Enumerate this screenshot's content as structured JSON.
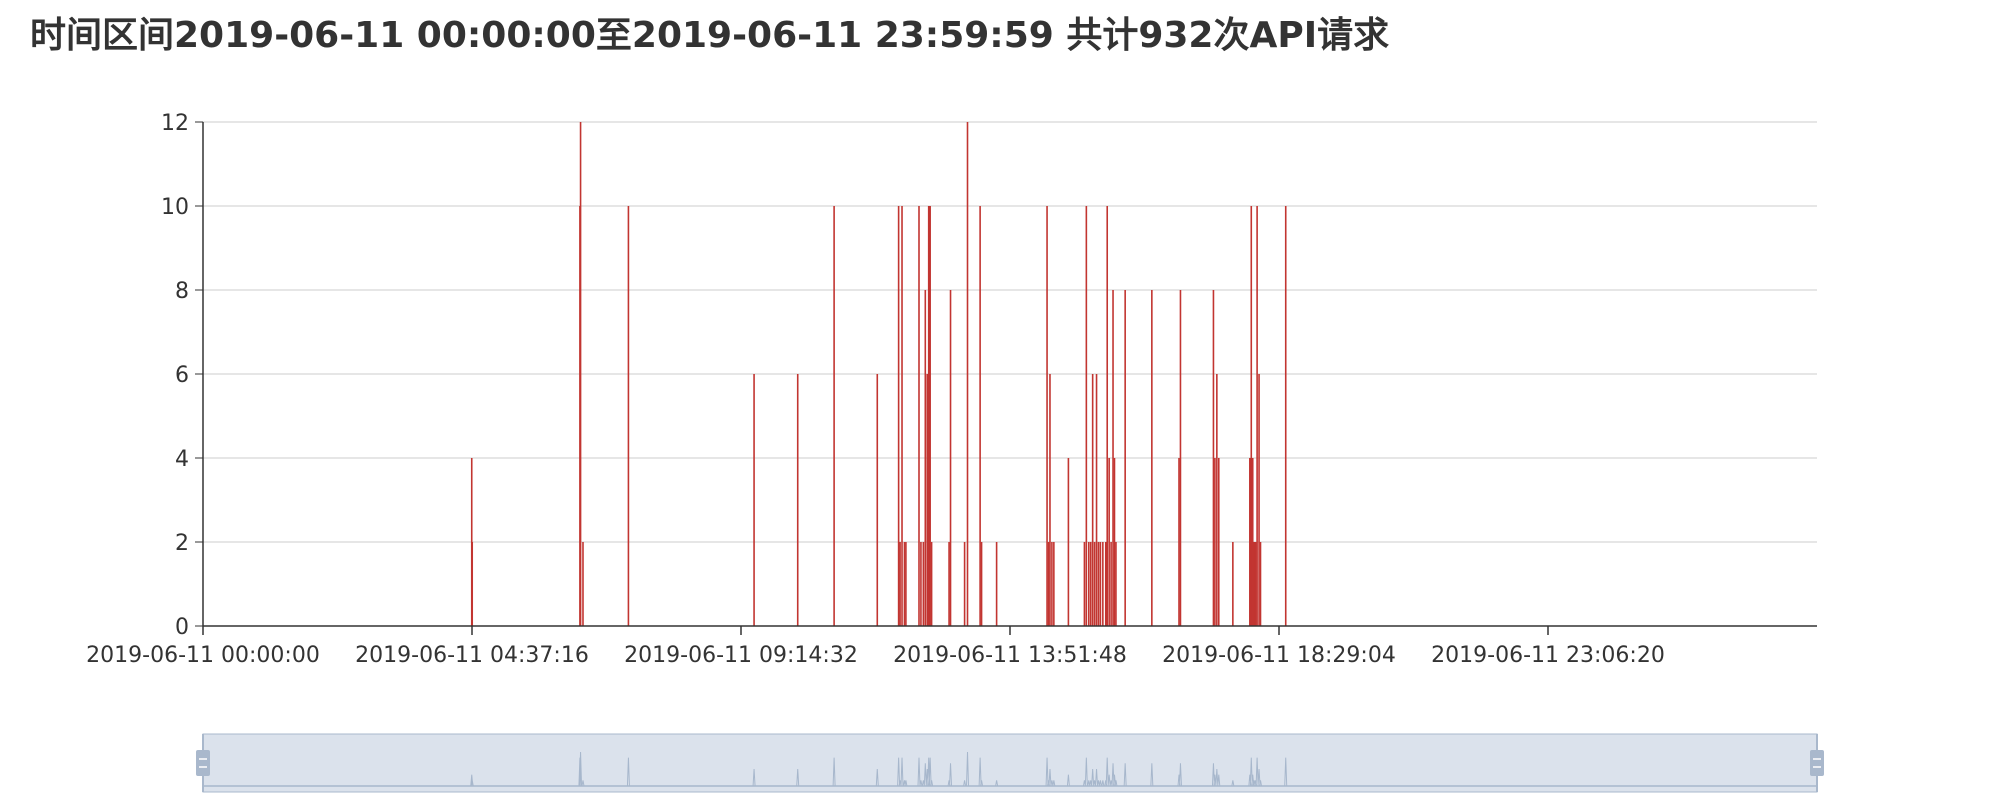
{
  "title": "时间区间2019-06-11 00:00:00至2019-06-11 23:59:59 共计932次API请求",
  "colors": {
    "series": "#c23531",
    "grid": "#cccccc",
    "axis": "#333333",
    "zoom_fill": "#dbe2ec",
    "zoom_border": "#a9b8cc",
    "zoom_shadow": "#a7b7cc"
  },
  "chart_data": {
    "type": "bar",
    "title": "时间区间2019-06-11 00:00:00至2019-06-11 23:59:59 共计932次API请求",
    "xlabel": "",
    "ylabel": "",
    "ylim": [
      0,
      12
    ],
    "y_ticks": [
      "0",
      "2",
      "4",
      "6",
      "8",
      "10",
      "12"
    ],
    "x_ticks": [
      "2019-06-11 00:00:00",
      "2019-06-11 04:37:16",
      "2019-06-11 09:14:32",
      "2019-06-11 13:51:48",
      "2019-06-11 18:29:04",
      "2019-06-11 23:06:20"
    ],
    "grid": true,
    "data_zoom": {
      "start_percent": 0,
      "end_percent": 100
    },
    "series": [
      {
        "values": [
          [
            "2019-06-11 04:37:00",
            4
          ],
          [
            "2019-06-11 04:37:30",
            2
          ],
          [
            "2019-06-11 06:28:30",
            10
          ],
          [
            "2019-06-11 06:29:10",
            12
          ],
          [
            "2019-06-11 06:31:40",
            2
          ],
          [
            "2019-06-11 07:18:30",
            10
          ],
          [
            "2019-06-11 09:28:00",
            6
          ],
          [
            "2019-06-11 10:13:00",
            6
          ],
          [
            "2019-06-11 10:50:30",
            10
          ],
          [
            "2019-06-11 11:35:00",
            6
          ],
          [
            "2019-06-11 11:57:00",
            10
          ],
          [
            "2019-06-11 11:58:30",
            2
          ],
          [
            "2019-06-11 12:00:30",
            10
          ],
          [
            "2019-06-11 12:03:00",
            2
          ],
          [
            "2019-06-11 12:04:30",
            2
          ],
          [
            "2019-06-11 12:18:00",
            10
          ],
          [
            "2019-06-11 12:20:00",
            2
          ],
          [
            "2019-06-11 12:22:30",
            2
          ],
          [
            "2019-06-11 12:24:30",
            8
          ],
          [
            "2019-06-11 12:26:30",
            6
          ],
          [
            "2019-06-11 12:28:00",
            10
          ],
          [
            "2019-06-11 12:29:30",
            10
          ],
          [
            "2019-06-11 12:31:00",
            2
          ],
          [
            "2019-06-11 12:49:00",
            2
          ],
          [
            "2019-06-11 12:50:30",
            8
          ],
          [
            "2019-06-11 13:05:00",
            2
          ],
          [
            "2019-06-11 13:08:00",
            12
          ],
          [
            "2019-06-11 13:21:00",
            10
          ],
          [
            "2019-06-11 13:22:30",
            2
          ],
          [
            "2019-06-11 13:38:00",
            2
          ],
          [
            "2019-06-11 14:30:00",
            10
          ],
          [
            "2019-06-11 14:31:30",
            2
          ],
          [
            "2019-06-11 14:33:00",
            6
          ],
          [
            "2019-06-11 14:35:00",
            2
          ],
          [
            "2019-06-11 14:37:00",
            2
          ],
          [
            "2019-06-11 14:52:00",
            4
          ],
          [
            "2019-06-11 15:08:30",
            2
          ],
          [
            "2019-06-11 15:10:30",
            10
          ],
          [
            "2019-06-11 15:13:00",
            2
          ],
          [
            "2019-06-11 15:15:00",
            2
          ],
          [
            "2019-06-11 15:17:00",
            6
          ],
          [
            "2019-06-11 15:19:00",
            2
          ],
          [
            "2019-06-11 15:21:00",
            6
          ],
          [
            "2019-06-11 15:23:00",
            2
          ],
          [
            "2019-06-11 15:25:00",
            2
          ],
          [
            "2019-06-11 15:27:30",
            2
          ],
          [
            "2019-06-11 15:30:30",
            2
          ],
          [
            "2019-06-11 15:32:00",
            10
          ],
          [
            "2019-06-11 15:34:00",
            4
          ],
          [
            "2019-06-11 15:36:00",
            2
          ],
          [
            "2019-06-11 15:38:00",
            8
          ],
          [
            "2019-06-11 15:39:30",
            4
          ],
          [
            "2019-06-11 15:41:00",
            2
          ],
          [
            "2019-06-11 15:50:30",
            8
          ],
          [
            "2019-06-11 16:18:00",
            8
          ],
          [
            "2019-06-11 16:46:00",
            4
          ],
          [
            "2019-06-11 16:47:30",
            8
          ],
          [
            "2019-06-11 17:21:30",
            8
          ],
          [
            "2019-06-11 17:23:00",
            4
          ],
          [
            "2019-06-11 17:25:00",
            6
          ],
          [
            "2019-06-11 17:27:00",
            4
          ],
          [
            "2019-06-11 17:41:30",
            2
          ],
          [
            "2019-06-11 17:59:00",
            4
          ],
          [
            "2019-06-11 18:00:30",
            10
          ],
          [
            "2019-06-11 18:02:00",
            4
          ],
          [
            "2019-06-11 18:03:30",
            2
          ],
          [
            "2019-06-11 18:05:00",
            2
          ],
          [
            "2019-06-11 18:06:30",
            10
          ],
          [
            "2019-06-11 18:08:30",
            6
          ],
          [
            "2019-06-11 18:10:00",
            2
          ],
          [
            "2019-06-11 18:36:00",
            10
          ]
        ]
      }
    ]
  }
}
